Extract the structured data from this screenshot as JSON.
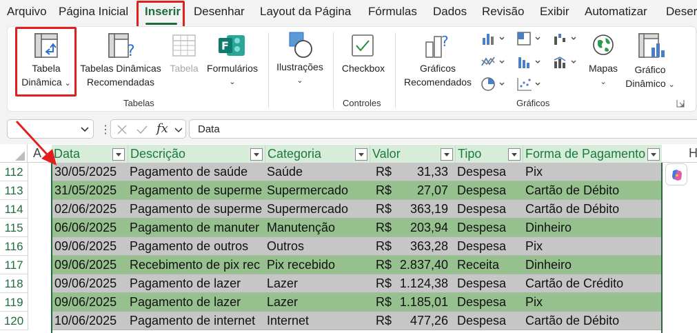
{
  "menu": {
    "items": [
      "Arquivo",
      "Página Inicial",
      "Inserir",
      "Desenhar",
      "Layout da Página",
      "Fórmulas",
      "Dados",
      "Revisão",
      "Exibir",
      "Automatizar",
      "Deser"
    ],
    "active": "Inserir"
  },
  "ribbon": {
    "tabelas": {
      "pivot_line1": "Tabela",
      "pivot_line2": "Dinâmica",
      "rec_line1": "Tabelas Dinâmicas",
      "rec_line2": "Recomendadas",
      "table": "Tabela",
      "forms": "Formulários",
      "group": "Tabelas"
    },
    "ilustracoes": "Ilustrações",
    "controles": {
      "checkbox": "Checkbox",
      "group": "Controles"
    },
    "graficos": {
      "rec_line1": "Gráficos",
      "rec_line2": "Recomendados",
      "maps": "Mapas",
      "pivot_chart_line1": "Gráfico",
      "pivot_chart_line2": "Dinâmico",
      "group": "Gráficos"
    }
  },
  "formula_bar": {
    "name_box": "",
    "content": "Data"
  },
  "sheet": {
    "col_a": "A",
    "col_h": "H",
    "headers": [
      "Data",
      "Descrição",
      "Categoria",
      "Valor",
      "Tipo",
      "Forma de Pagamento"
    ],
    "rows": [
      {
        "n": "112",
        "data": "30/05/2025",
        "desc": "Pagamento de saúde",
        "cat": "Saúde",
        "cur": "R$",
        "val": "31,33",
        "tipo": "Despesa",
        "forma": "Pix"
      },
      {
        "n": "113",
        "data": "31/05/2025",
        "desc": "Pagamento de superme",
        "cat": "Supermercado",
        "cur": "R$",
        "val": "27,07",
        "tipo": "Despesa",
        "forma": "Cartão de Débito"
      },
      {
        "n": "114",
        "data": "02/06/2025",
        "desc": "Pagamento de superme",
        "cat": "Supermercado",
        "cur": "R$",
        "val": "363,19",
        "tipo": "Despesa",
        "forma": "Cartão de Débito"
      },
      {
        "n": "115",
        "data": "06/06/2025",
        "desc": "Pagamento de manuter",
        "cat": "Manutenção",
        "cur": "R$",
        "val": "203,94",
        "tipo": "Despesa",
        "forma": "Dinheiro"
      },
      {
        "n": "116",
        "data": "09/06/2025",
        "desc": "Pagamento de outros",
        "cat": "Outros",
        "cur": "R$",
        "val": "363,28",
        "tipo": "Despesa",
        "forma": "Pix"
      },
      {
        "n": "117",
        "data": "09/06/2025",
        "desc": "Recebimento de pix rec",
        "cat": "Pix recebido",
        "cur": "R$",
        "val": "2.837,40",
        "tipo": "Receita",
        "forma": "Dinheiro"
      },
      {
        "n": "118",
        "data": "09/06/2025",
        "desc": "Pagamento de lazer",
        "cat": "Lazer",
        "cur": "R$",
        "val": "1.124,38",
        "tipo": "Despesa",
        "forma": "Cartão de Crédito"
      },
      {
        "n": "119",
        "data": "09/06/2025",
        "desc": "Pagamento de lazer",
        "cat": "Lazer",
        "cur": "R$",
        "val": "1.185,01",
        "tipo": "Despesa",
        "forma": "Pix"
      },
      {
        "n": "120",
        "data": "10/06/2025",
        "desc": "Pagamento de internet",
        "cat": "Internet",
        "cur": "R$",
        "val": "477,26",
        "tipo": "Despesa",
        "forma": "Cartão de Débito"
      }
    ]
  },
  "colors": {
    "accent": "#1e6b3a",
    "highlight_red": "#e0201c",
    "row_gray": "#c6c6c6",
    "row_green": "#97c08f",
    "header_green": "#d7ecd9"
  }
}
